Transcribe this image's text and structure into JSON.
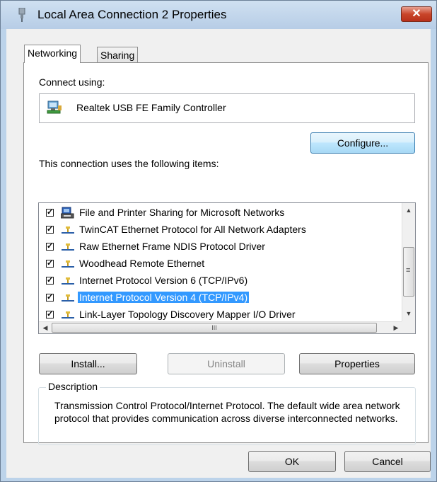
{
  "window": {
    "title": "Local Area Connection 2 Properties",
    "close_label": "✕"
  },
  "tabs": [
    {
      "label": "Networking",
      "active": true
    },
    {
      "label": "Sharing",
      "active": false
    }
  ],
  "connect": {
    "label": "Connect using:",
    "adapter": "Realtek USB FE Family Controller",
    "adapter_icon": "network-adapter-icon",
    "configure_label": "Configure..."
  },
  "items_section": {
    "label": "This connection uses the following items:",
    "items": [
      {
        "label": "File and Printer Sharing for Microsoft Networks",
        "checked": true,
        "icon": "printer-icon"
      },
      {
        "label": "TwinCAT Ethernet Protocol for All Network Adapters",
        "checked": true,
        "icon": "protocol-icon"
      },
      {
        "label": "Raw Ethernet Frame NDIS Protocol Driver",
        "checked": true,
        "icon": "protocol-icon"
      },
      {
        "label": "Woodhead Remote Ethernet",
        "checked": true,
        "icon": "protocol-icon"
      },
      {
        "label": "Internet Protocol Version 6 (TCP/IPv6)",
        "checked": true,
        "icon": "protocol-icon"
      },
      {
        "label": "Internet Protocol Version 4 (TCP/IPv4)",
        "checked": true,
        "icon": "protocol-icon",
        "selected": true
      },
      {
        "label": "Link-Layer Topology Discovery Mapper I/O Driver",
        "checked": true,
        "icon": "protocol-icon"
      }
    ],
    "scroll_grip": "III",
    "vscroll_grip": "≡"
  },
  "buttons": {
    "install": "Install...",
    "uninstall": "Uninstall",
    "properties": "Properties",
    "ok": "OK",
    "cancel": "Cancel"
  },
  "description": {
    "legend": "Description",
    "text": "Transmission Control Protocol/Internet Protocol. The default wide area network protocol that provides communication across diverse interconnected networks."
  },
  "colors": {
    "selection": "#3399ff",
    "title_bg": "#bcd3ea",
    "close_red": "#c9452a"
  }
}
